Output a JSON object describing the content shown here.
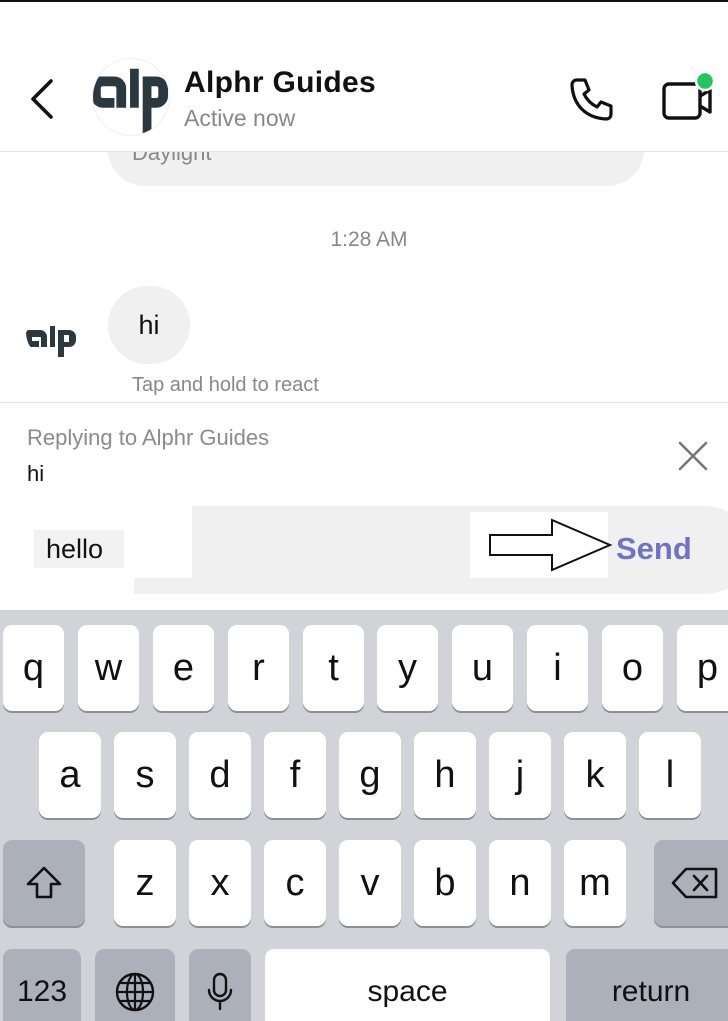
{
  "header": {
    "contact_name": "Alphr Guides",
    "status": "Active now",
    "avatar_text": "alp"
  },
  "conversation": {
    "previous_message": "Daylight",
    "timestamp": "1:28 AM",
    "message": "hi",
    "hint": "Tap and hold to react"
  },
  "reply": {
    "label": "Replying to Alphr Guides",
    "snippet": "hi"
  },
  "compose": {
    "value": "hello",
    "send_label": "Send"
  },
  "keyboard": {
    "row1": [
      "q",
      "w",
      "e",
      "r",
      "t",
      "y",
      "u",
      "i",
      "o",
      "p"
    ],
    "row2": [
      "a",
      "s",
      "d",
      "f",
      "g",
      "h",
      "j",
      "k",
      "l"
    ],
    "row3": [
      "z",
      "x",
      "c",
      "v",
      "b",
      "n",
      "m"
    ],
    "numbers_label": "123",
    "space_label": "space",
    "return_label": "return"
  },
  "colors": {
    "accent": "#7072c6",
    "online_dot": "#22c55e",
    "keyboard_bg": "#d1d3d9",
    "bubble_bg": "#f0f0f0"
  },
  "icons": {
    "back": "chevron-left-icon",
    "call": "phone-icon",
    "video": "video-camera-icon",
    "close": "close-icon",
    "shift": "shift-icon",
    "delete": "backspace-icon",
    "globe": "globe-icon",
    "mic": "microphone-icon"
  }
}
